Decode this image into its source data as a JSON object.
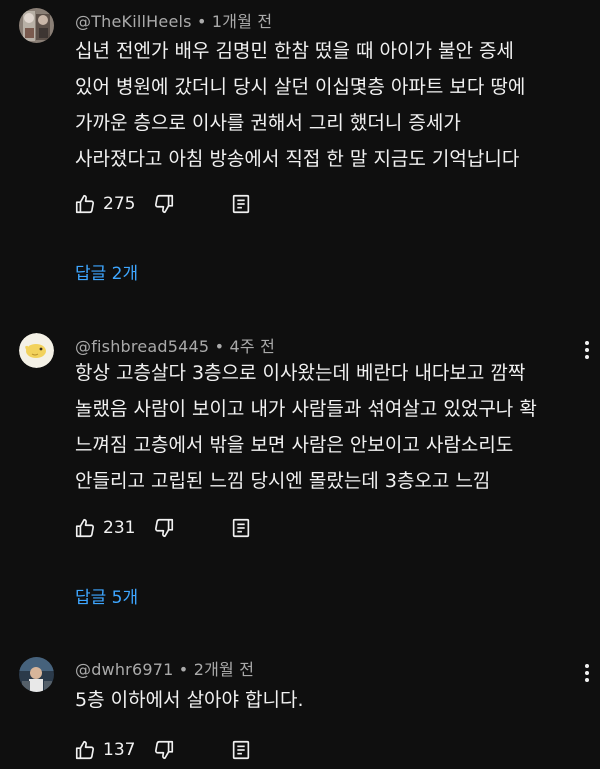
{
  "comments": [
    {
      "handle": "@TheKillHeels",
      "time": "1개월 전",
      "lines": [
        "십년 전엔가 배우 김명민 한참 떴을 때 아이가 불안 증세",
        "있어 병원에 갔더니 당시 살던 이십몇층 아파트 보다 땅에",
        "가까운 층으로 이사를 권해서 그리 했더니 증세가",
        "사라졌다고 아침 방송에서 직접 한 말 지금도 기억납니다"
      ],
      "likes": "275",
      "replies": "답글 2개"
    },
    {
      "handle": "@fishbread5445",
      "time": "4주 전",
      "lines": [
        "항상 고층살다 3층으로 이사왔는데 베란다 내다보고 깜짝",
        "놀랬음 사람이 보이고 내가 사람들과 섞여살고 있었구나 확",
        "느껴짐 고층에서 밖을 보면 사람은 안보이고 사람소리도",
        "안들리고 고립된 느낌 당시엔 몰랐는데 3층오고 느낌"
      ],
      "likes": "231",
      "replies": "답글 5개"
    },
    {
      "handle": "@dwhr6971",
      "time": "2개월 전",
      "lines": [
        "5층 이하에서 살아야 합니다."
      ],
      "likes": "137"
    }
  ],
  "icons": {
    "like": "thumbs-up-icon",
    "dislike": "thumbs-down-icon",
    "reply": "reply-icon",
    "more": "more-vert-icon"
  },
  "colors": {
    "background": "#0f0f0f",
    "text": "#f1f1f1",
    "meta": "#aaaaaa",
    "link": "#3ea6ff"
  }
}
